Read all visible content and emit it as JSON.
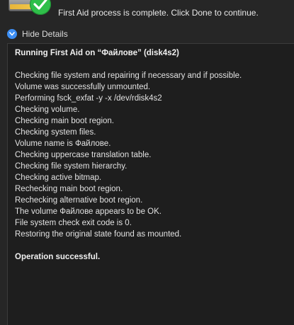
{
  "status": {
    "message": "First Aid process is complete. Click Done to continue."
  },
  "details_toggle": {
    "label": "Hide Details"
  },
  "log": {
    "title": "Running First Aid on “Файлове” (disk4s2)",
    "lines": [
      "Checking file system and repairing if necessary and if possible.",
      "Volume was successfully unmounted.",
      "Performing fsck_exfat -y -x /dev/rdisk4s2",
      "Checking volume.",
      "Checking main boot region.",
      "Checking system files.",
      "Volume name is Файлове.",
      "Checking uppercase translation table.",
      "Checking file system hierarchy.",
      "Checking active bitmap.",
      "Rechecking main boot region.",
      "Rechecking alternative boot region.",
      "The volume Файлове appears to be OK.",
      "File system check exit code is 0.",
      "Restoring the original state found as mounted."
    ],
    "result": "Operation successful."
  },
  "icons": {
    "drive": "external-drive-icon",
    "check": "success-check-icon",
    "toggle": "chevron-down-icon"
  },
  "colors": {
    "background": "#262626",
    "log_background": "#1e1e1e",
    "success_green": "#2fbf4a",
    "accent_blue": "#3d8ff5"
  }
}
